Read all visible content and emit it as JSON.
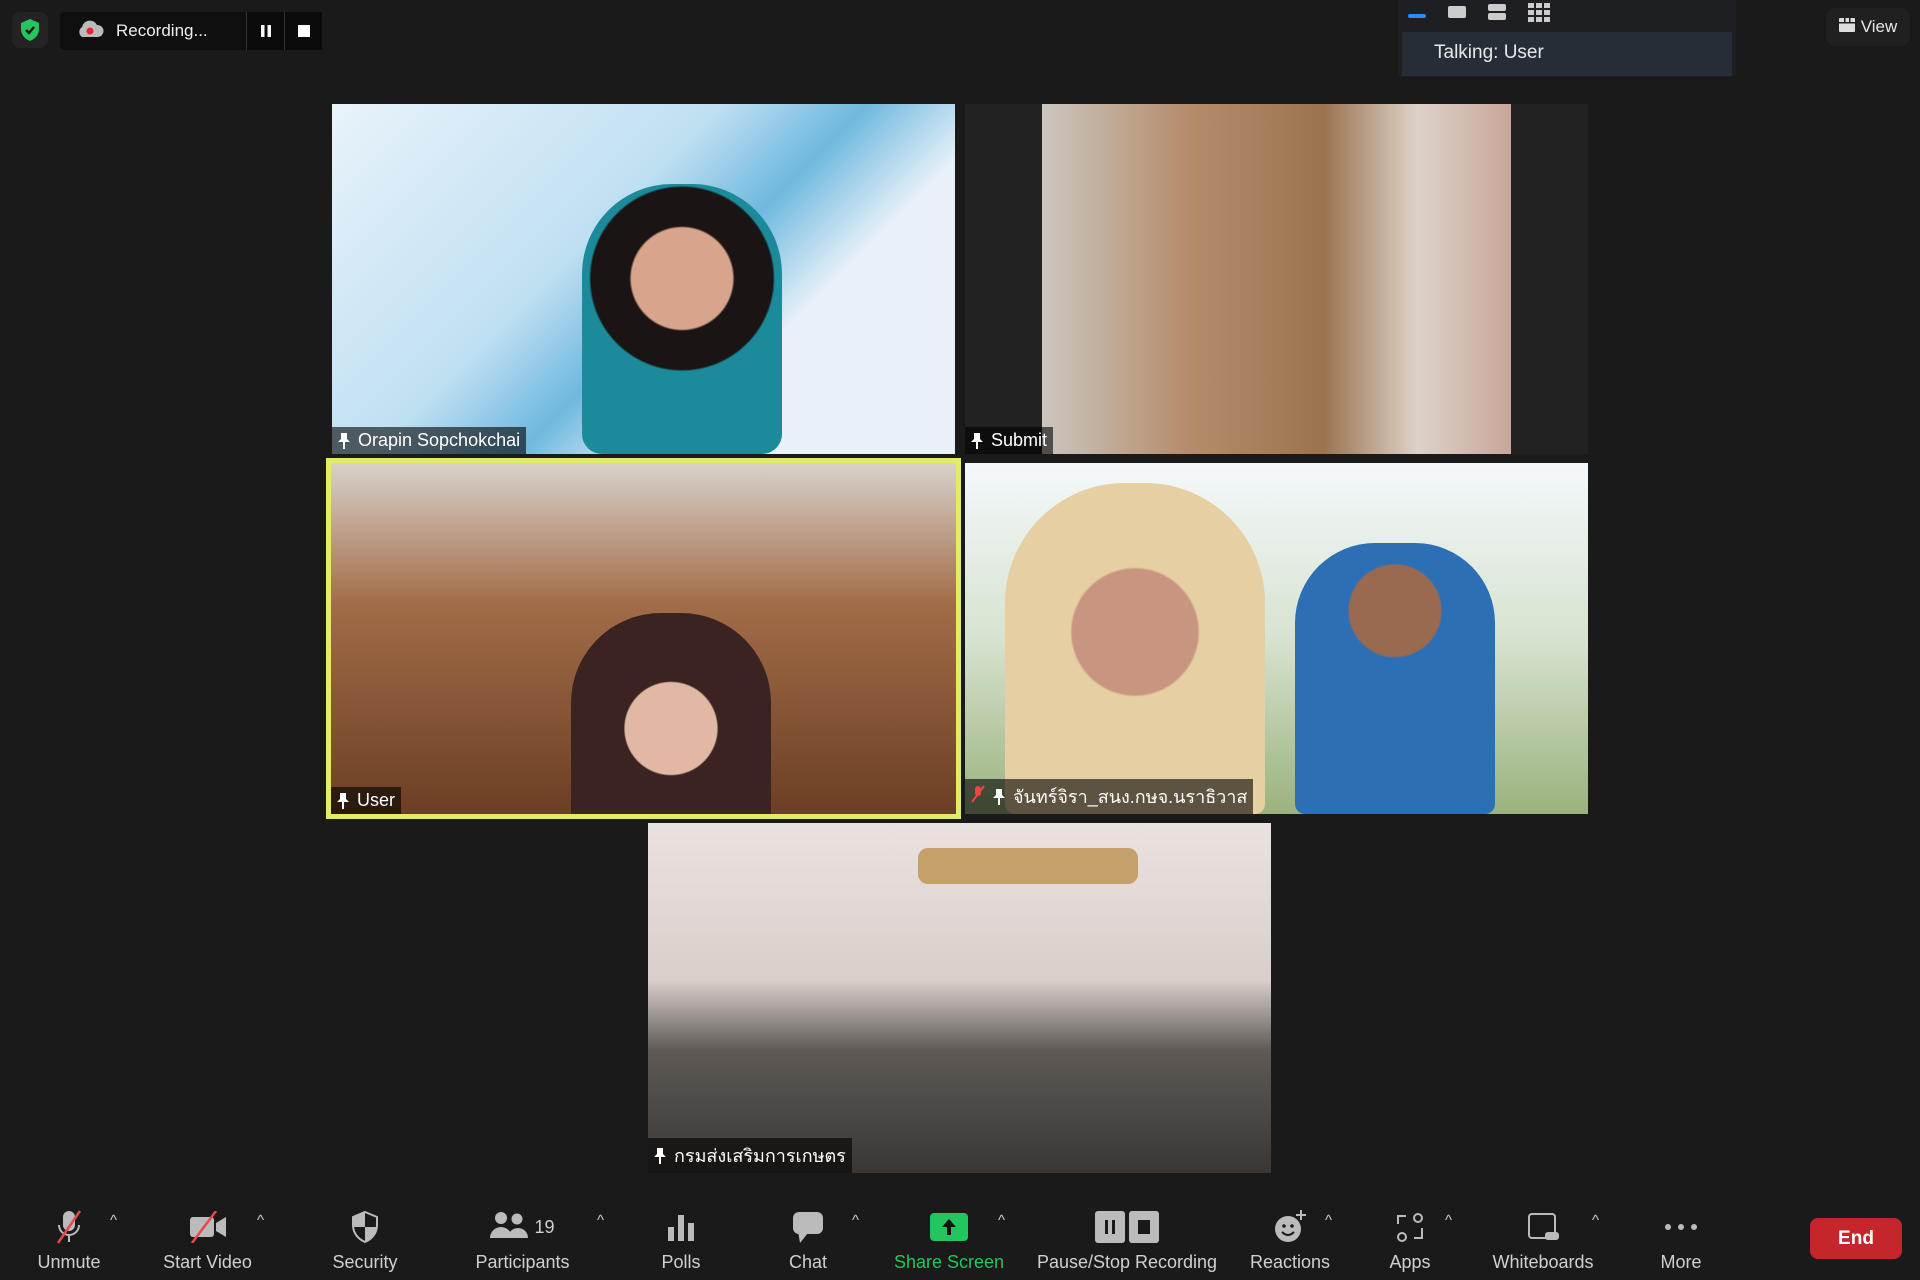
{
  "recording": {
    "label": "Recording..."
  },
  "layout_popup": {
    "talking": "Talking: User"
  },
  "view": {
    "label": "View"
  },
  "tiles": [
    {
      "name": "Orapin Sopchokchai"
    },
    {
      "name": "Submit"
    },
    {
      "name": "User",
      "active_speaker": true
    },
    {
      "name": "จันทร์จิรา_สนง.กษจ.นราธิวาส",
      "muted": true
    },
    {
      "name": "กรมส่งเสริมการเกษตร"
    }
  ],
  "toolbar": {
    "unmute": "Unmute",
    "start_video": "Start Video",
    "security": "Security",
    "participants": "Participants",
    "participants_count": "19",
    "polls": "Polls",
    "chat": "Chat",
    "share_screen": "Share Screen",
    "pause_stop": "Pause/Stop Recording",
    "reactions": "Reactions",
    "apps": "Apps",
    "whiteboards": "Whiteboards",
    "more": "More",
    "end": "End"
  },
  "colors": {
    "share": "#22c55e",
    "end": "#c4262b",
    "active_border": "#e2ec6a",
    "shield": "#22c55e"
  }
}
